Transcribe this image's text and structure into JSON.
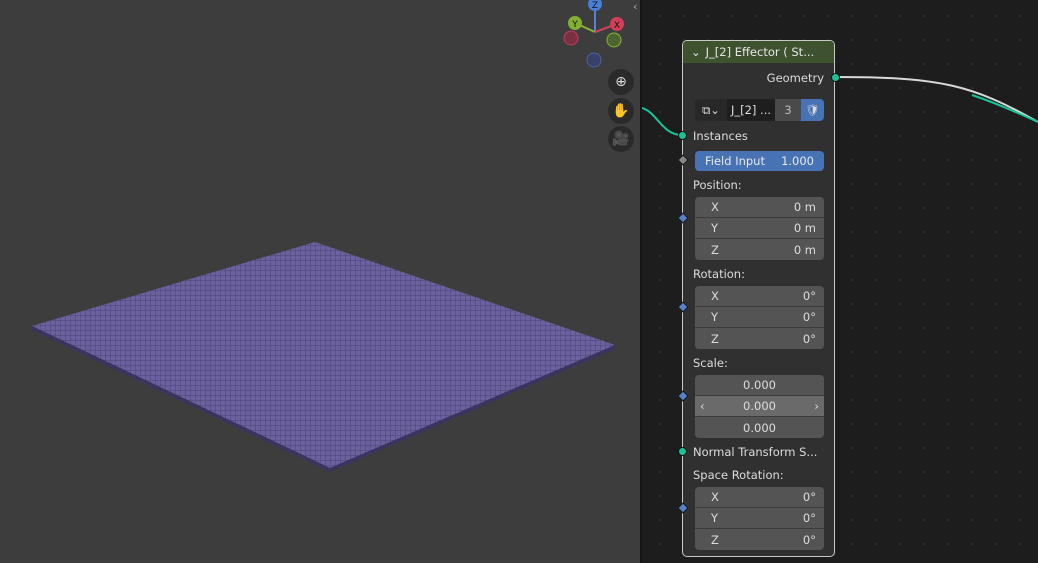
{
  "viewport": {
    "gizmo": {
      "x": "X",
      "y": "Y",
      "z": "Z"
    },
    "icons": [
      "zoom-icon",
      "hand-pan-icon",
      "camera-icon"
    ]
  },
  "node": {
    "title": "J_[2] Effector ( St...",
    "output_geometry": "Geometry",
    "selector": {
      "name": "J_[2] ...",
      "count": "3"
    },
    "instances": "Instances",
    "field_input": {
      "label": "Field Input",
      "value": "1.000"
    },
    "position": {
      "label": "Position:",
      "rows": [
        {
          "axis": "X",
          "value": "0 m"
        },
        {
          "axis": "Y",
          "value": "0 m"
        },
        {
          "axis": "Z",
          "value": "0 m"
        }
      ]
    },
    "rotation": {
      "label": "Rotation:",
      "rows": [
        {
          "axis": "X",
          "value": "0°"
        },
        {
          "axis": "Y",
          "value": "0°"
        },
        {
          "axis": "Z",
          "value": "0°"
        }
      ]
    },
    "scale": {
      "label": "Scale:",
      "values": [
        "0.000",
        "0.000",
        "0.000"
      ]
    },
    "normal_transform": "Normal Transform S...",
    "space_rotation": {
      "label": "Space Rotation:",
      "rows": [
        {
          "axis": "X",
          "value": "0°"
        },
        {
          "axis": "Y",
          "value": "0°"
        },
        {
          "axis": "Z",
          "value": "0°"
        }
      ]
    }
  },
  "colors": {
    "header": "#3f5230",
    "field": "#4772b3",
    "socket_geometry": "#19c39b",
    "socket_vector": "#5a80c8",
    "plane": "#6a5f9e"
  }
}
